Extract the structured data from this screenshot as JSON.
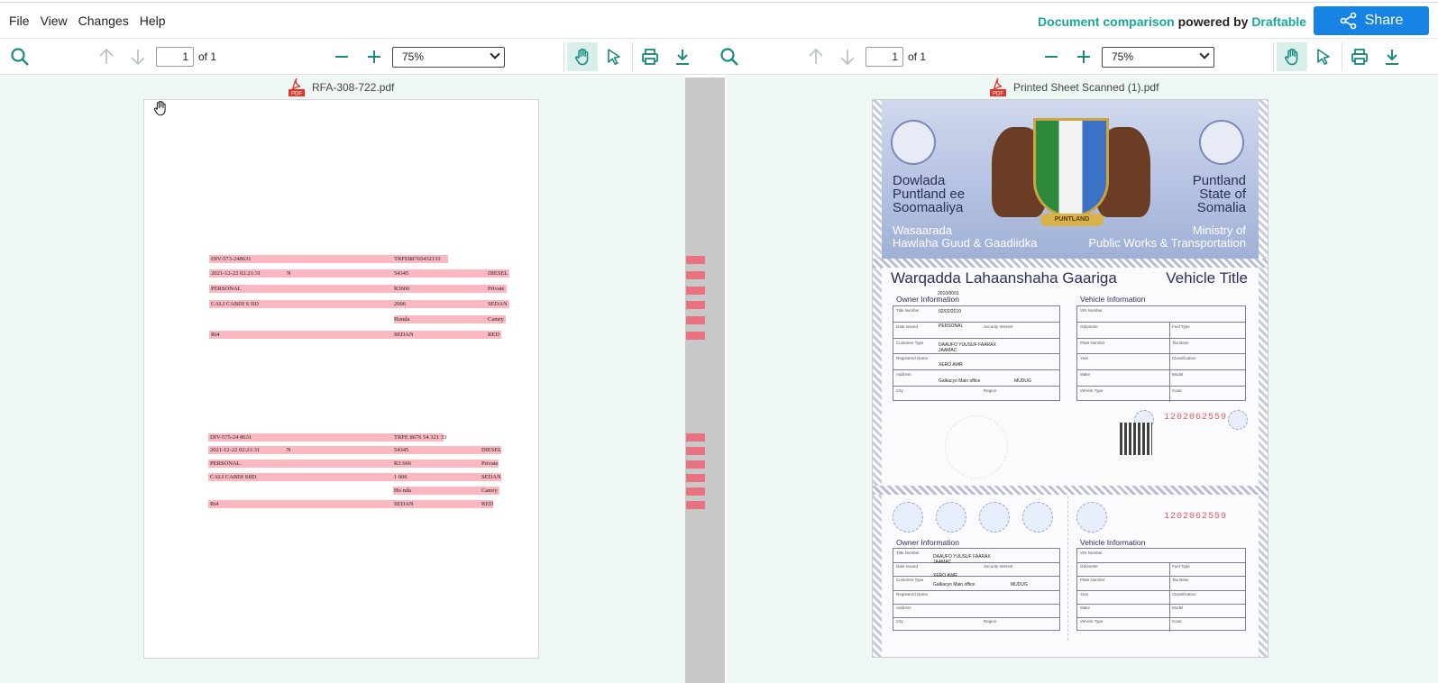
{
  "menu": [
    "File",
    "View",
    "Changes",
    "Help"
  ],
  "brand": {
    "text1": "Document comparison",
    "text2": "powered by",
    "text3": "Draftable"
  },
  "share": {
    "label": "Share"
  },
  "left": {
    "page": "1",
    "of": "of 1",
    "zoom": "75%",
    "filename": "RFA-308-722.pdf",
    "block1": [
      {
        "a": "DIV-573-248631",
        "b": "",
        "c": "TRFE88765432133",
        "d": ""
      },
      {
        "a": "2021-12-22 02:21:31",
        "b": "N",
        "c": "54345",
        "d": "DIESEL"
      },
      {
        "a": "PERSONAL",
        "b": "",
        "c": "R3666",
        "d": "Private"
      },
      {
        "a": "CALI CABDI S IID",
        "b": "",
        "c": "2006",
        "d": "SEDAN"
      },
      {
        "a": "",
        "b": "",
        "c": "Honda",
        "d": "Camry"
      },
      {
        "a": "Rt4",
        "b": "",
        "c": "SEDAN",
        "d": "RED"
      }
    ],
    "block2": [
      {
        "a": "DIV-575-24 8631",
        "b": "",
        "c": "TRFE 8676 54 321 33",
        "d": ""
      },
      {
        "a": "2021-12-22 02:21:31",
        "b": "N",
        "c": "54345",
        "d": "DIESEL"
      },
      {
        "a": "PERSONAL",
        "b": "",
        "c": "R3 666",
        "d": "Private"
      },
      {
        "a": "CALI CABDI SIID",
        "b": "",
        "c": "1 006",
        "d": "SEDAN"
      },
      {
        "a": "",
        "b": "",
        "c": "Ho nda",
        "d": "Camry"
      },
      {
        "a": "Rt4",
        "b": "",
        "c": "SEDAN",
        "d": "RED"
      }
    ]
  },
  "right": {
    "page": "1",
    "of": "of 1",
    "zoom": "75%",
    "filename": "Printed Sheet Scanned (1).pdf",
    "doc": {
      "left_title": [
        "Dowlada",
        "Puntland ee",
        "Soomaaliya"
      ],
      "right_title": [
        "Puntland",
        "State of",
        "Somalia"
      ],
      "left_ministry": [
        "Wasaarada",
        "Hawlaha Guud & Gaadiidka"
      ],
      "right_ministry": [
        "Ministry of",
        "Public Works & Transportation"
      ],
      "banner": "PUNTLAND",
      "title_so": "Warqadda Lahaanshaha Gaariga",
      "title_en": "Vehicle Title",
      "owner_info": "Owner Information",
      "vehicle_info": "Vehicle Information",
      "serial": "1202062559",
      "owner_labels": [
        "Title Number",
        "Date Issued",
        "Customer Type",
        "Registered Name",
        "Address",
        "City"
      ],
      "owner_values": [
        "02/02/2010",
        "PERSONAL",
        "DAAUFO YUUSUF FAARAX JAAMAC",
        "XERO AWR",
        "Galkacyo Main office",
        ""
      ],
      "sec_interest": "Security Interest",
      "region": "Region",
      "mudug": "MUDUG",
      "vehicle_labels": [
        "VIN Number",
        "Odometer",
        "Plate Number",
        "Year",
        "Make",
        "Vehicle Type"
      ],
      "vehicle_labels2": [
        "",
        "Fuel Type",
        "Tax Base",
        "Classification",
        "Model",
        "Color"
      ],
      "code_top": "2010/0001"
    }
  }
}
